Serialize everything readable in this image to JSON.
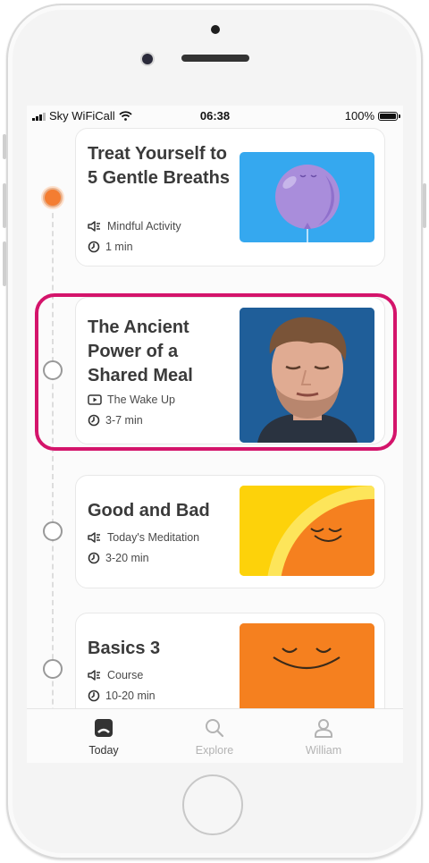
{
  "status_bar": {
    "carrier": "Sky WiFiCall",
    "time": "06:38",
    "battery": "100%"
  },
  "cards": [
    {
      "title": "Treat Yourself to 5 Gentle Breaths",
      "type_label": "Mindful Activity",
      "type_icon": "audio-icon",
      "duration": "1 min",
      "thumb_bg": "#35a8ef",
      "state": "active"
    },
    {
      "title": "The Ancient Power of a Shared Meal",
      "type_label": "The Wake Up",
      "type_icon": "video-icon",
      "duration": "3-7 min",
      "thumb_bg": "#1f5e99",
      "state": "highlighted"
    },
    {
      "title": "Good and Bad",
      "type_label": "Today's Meditation",
      "type_icon": "audio-icon",
      "duration": "3-20 min",
      "thumb_bg": "#fdd20a",
      "state": "default"
    },
    {
      "title": "Basics 3",
      "type_label": "Course",
      "type_icon": "audio-icon",
      "duration": "10-20 min",
      "thumb_bg": "#f5801f",
      "state": "default"
    }
  ],
  "tabs": [
    {
      "label": "Today",
      "icon": "today-icon",
      "selected": true
    },
    {
      "label": "Explore",
      "icon": "search-icon",
      "selected": false
    },
    {
      "label": "William",
      "icon": "profile-icon",
      "selected": false
    }
  ],
  "colors": {
    "accent_orange": "#f47d31",
    "highlight_magenta": "#d4146b",
    "tab_selected": "#333333",
    "tab_unselected": "#b3b3b3"
  }
}
